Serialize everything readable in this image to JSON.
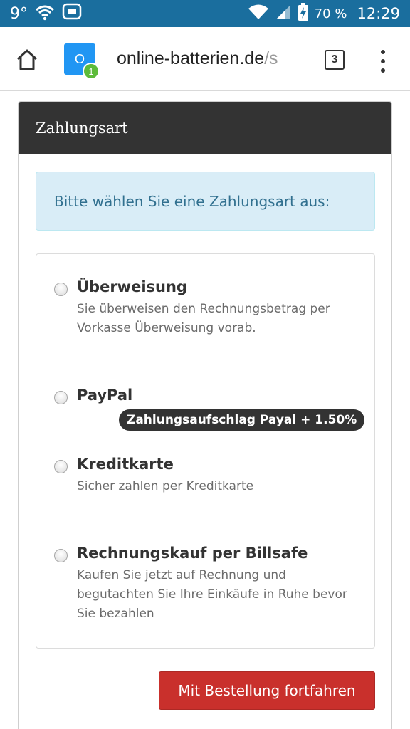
{
  "status_bar": {
    "temperature": "9°",
    "battery_percent": "70 %",
    "time": "12:29",
    "icons": [
      "wifi-icon",
      "message-icon",
      "wifi-signal-icon",
      "cell-signal-icon",
      "battery-charging-icon"
    ]
  },
  "browser": {
    "favicon_letter": "O",
    "notification_count": "1",
    "url_host": "online-batterien.de",
    "url_rest": "/s",
    "tab_count": "3",
    "icons": [
      "home-icon",
      "more-vert-icon"
    ]
  },
  "panel": {
    "title": "Zahlungsart",
    "alert": "Bitte wählen Sie eine Zahlungsart aus:",
    "options": [
      {
        "title": "Überweisung",
        "description": "Sie überweisen den Rechnungsbetrag per Vorkasse Überweisung vorab.",
        "selected": false
      },
      {
        "title": "PayPal",
        "badge": "Zahlungsaufschlag Payal + 1.50%",
        "selected": false
      },
      {
        "title": "Kreditkarte",
        "description": "Sicher zahlen per Kreditkarte",
        "selected": false
      },
      {
        "title": "Rechnungskauf per Billsafe",
        "description": "Kaufen Sie jetzt auf Rechnung und begutachten Sie Ihre Einkäufe in Ruhe bevor Sie bezahlen",
        "selected": false
      }
    ],
    "continue_label": "Mit Bestellung fortfahren"
  },
  "colors": {
    "status_bar": "#1a6e9e",
    "panel_header": "#333333",
    "alert_bg": "#d9edf7",
    "alert_text": "#31708f",
    "primary_button": "#c9302c"
  }
}
